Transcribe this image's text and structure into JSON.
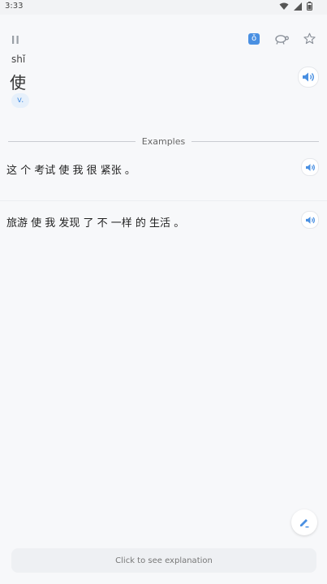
{
  "status_bar": {
    "time": "3:33",
    "icons": [
      "wifi-icon",
      "signal-icon",
      "battery-icon"
    ]
  },
  "toolbar": {
    "left_icon": "pause-icon",
    "right_icons": [
      "pinyin-toggle-icon",
      "turtle-slow-icon",
      "star-icon"
    ],
    "pinyin_toggle_glyph": "ǒ"
  },
  "word": {
    "pinyin": "shǐ",
    "hanzi": "使",
    "pos": "v."
  },
  "examples": {
    "label": "Examples",
    "items": [
      {
        "sentence": "这 个 考试 使 我 很 紧张 。"
      },
      {
        "sentence": "旅游 使 我 发现 了 不 一样 的 生活 。"
      }
    ]
  },
  "explanation": {
    "label": "Click to see explanation"
  },
  "colors": {
    "accent": "#4a90e2",
    "background": "#f7f8fa"
  }
}
